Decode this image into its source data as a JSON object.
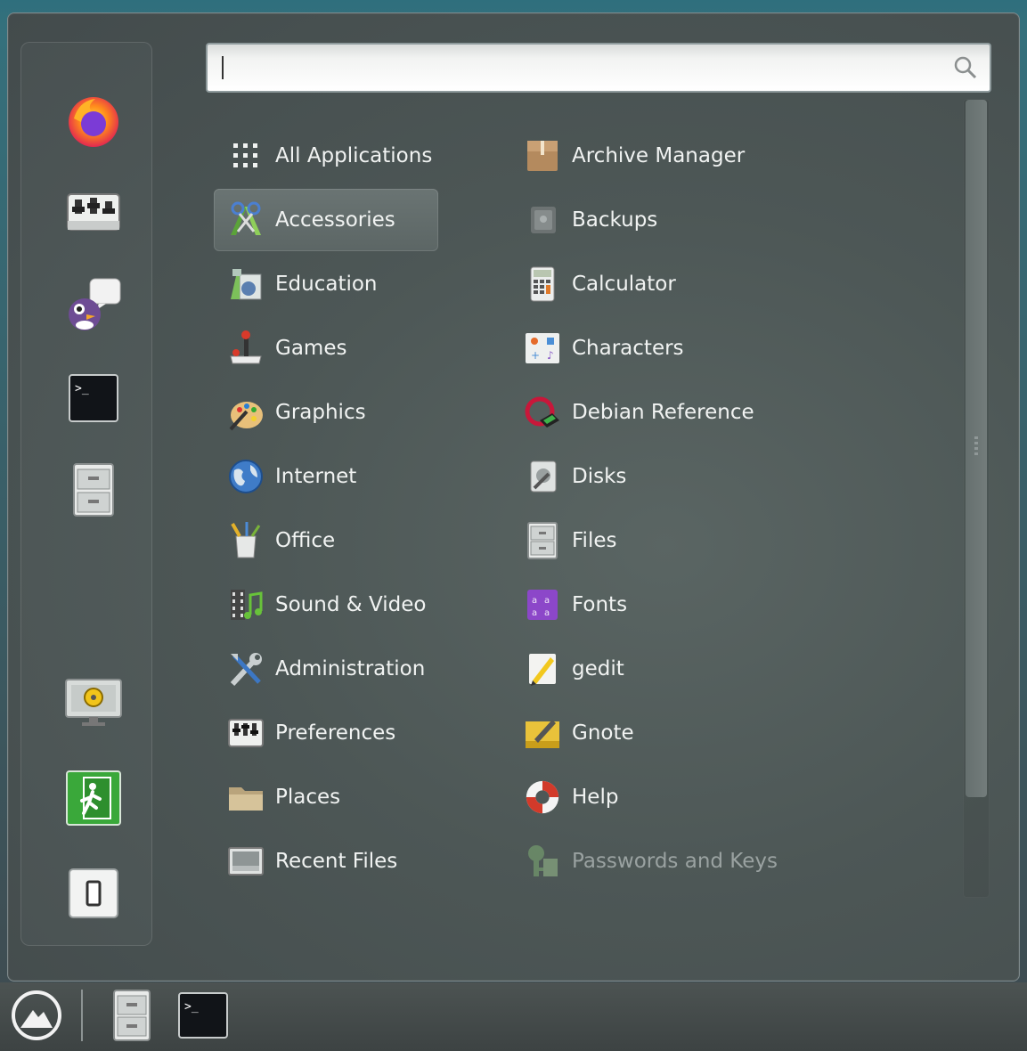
{
  "search": {
    "placeholder": "",
    "value": ""
  },
  "favorites": [
    {
      "name": "firefox-icon"
    },
    {
      "name": "settings-mixer-icon"
    },
    {
      "name": "pidgin-chat-icon"
    },
    {
      "name": "terminal-icon"
    },
    {
      "name": "files-cabinet-icon"
    },
    {
      "name": "lock-screen-icon"
    },
    {
      "name": "logout-icon"
    },
    {
      "name": "shutdown-icon"
    }
  ],
  "categories": [
    {
      "label": "All Applications",
      "icon": "grid-icon"
    },
    {
      "label": "Accessories",
      "icon": "accessories-icon"
    },
    {
      "label": "Education",
      "icon": "education-icon"
    },
    {
      "label": "Games",
      "icon": "games-icon"
    },
    {
      "label": "Graphics",
      "icon": "graphics-icon"
    },
    {
      "label": "Internet",
      "icon": "internet-globe-icon"
    },
    {
      "label": "Office",
      "icon": "office-icon"
    },
    {
      "label": "Sound & Video",
      "icon": "sound-video-icon"
    },
    {
      "label": "Administration",
      "icon": "administration-icon"
    },
    {
      "label": "Preferences",
      "icon": "preferences-icon"
    },
    {
      "label": "Places",
      "icon": "folder-icon"
    },
    {
      "label": "Recent Files",
      "icon": "recent-files-icon"
    }
  ],
  "apps": [
    {
      "label": "Archive Manager",
      "icon": "archive-box-icon"
    },
    {
      "label": "Backups",
      "icon": "backups-icon"
    },
    {
      "label": "Calculator",
      "icon": "calculator-icon"
    },
    {
      "label": "Characters",
      "icon": "characters-icon"
    },
    {
      "label": "Debian Reference",
      "icon": "debian-reference-icon"
    },
    {
      "label": "Disks",
      "icon": "disks-icon"
    },
    {
      "label": "Files",
      "icon": "files-cabinet-icon"
    },
    {
      "label": "Fonts",
      "icon": "fonts-icon"
    },
    {
      "label": "gedit",
      "icon": "text-editor-icon"
    },
    {
      "label": "Gnote",
      "icon": "note-icon"
    },
    {
      "label": "Help",
      "icon": "lifebuoy-icon"
    },
    {
      "label": "Passwords and Keys",
      "icon": "keys-icon"
    }
  ],
  "taskbar": {
    "menu_icon": "cinnamon-menu-icon",
    "apps": [
      "files-cabinet-icon",
      "terminal-icon"
    ]
  }
}
